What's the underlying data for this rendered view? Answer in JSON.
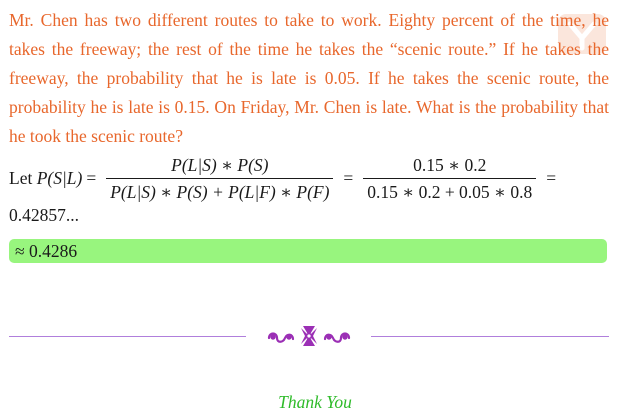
{
  "problem": {
    "text": "Mr. Chen has two different routes to take to work. Eighty percent of the time, he takes the freeway; the rest of the time he takes the “scenic route.” If he takes the freeway, the probability that he is late is 0.05. If he takes the scenic route, the probability he is late is 0.15. On Friday, Mr. Chen is late. What is the probability that he took the scenic route?"
  },
  "solution": {
    "intro": "Let",
    "lhs": "P(S|L)",
    "eq1": "=",
    "frac1_num": "P(L|S) ∗ P(S)",
    "frac1_den": "P(L|S) ∗ P(S) + P(L|F) ∗ P(F)",
    "eq2": "=",
    "frac2_num": "0.15 ∗ 0.2",
    "frac2_den": "0.15 ∗ 0.2 + 0.05 ∗ 0.8",
    "eq3": "=",
    "result": "0.42857..."
  },
  "answer": {
    "text": "≈ 0.4286",
    "highlight_color": "#98f57e"
  },
  "footer": {
    "thanks": "Thank You",
    "ornament_icon": "floral-ornament-icon",
    "rule_color": "#b07fdc"
  },
  "colors": {
    "problem_text": "#e8672c",
    "thanks_text": "#2fbb2a",
    "ornament": "#9b2fb5"
  }
}
